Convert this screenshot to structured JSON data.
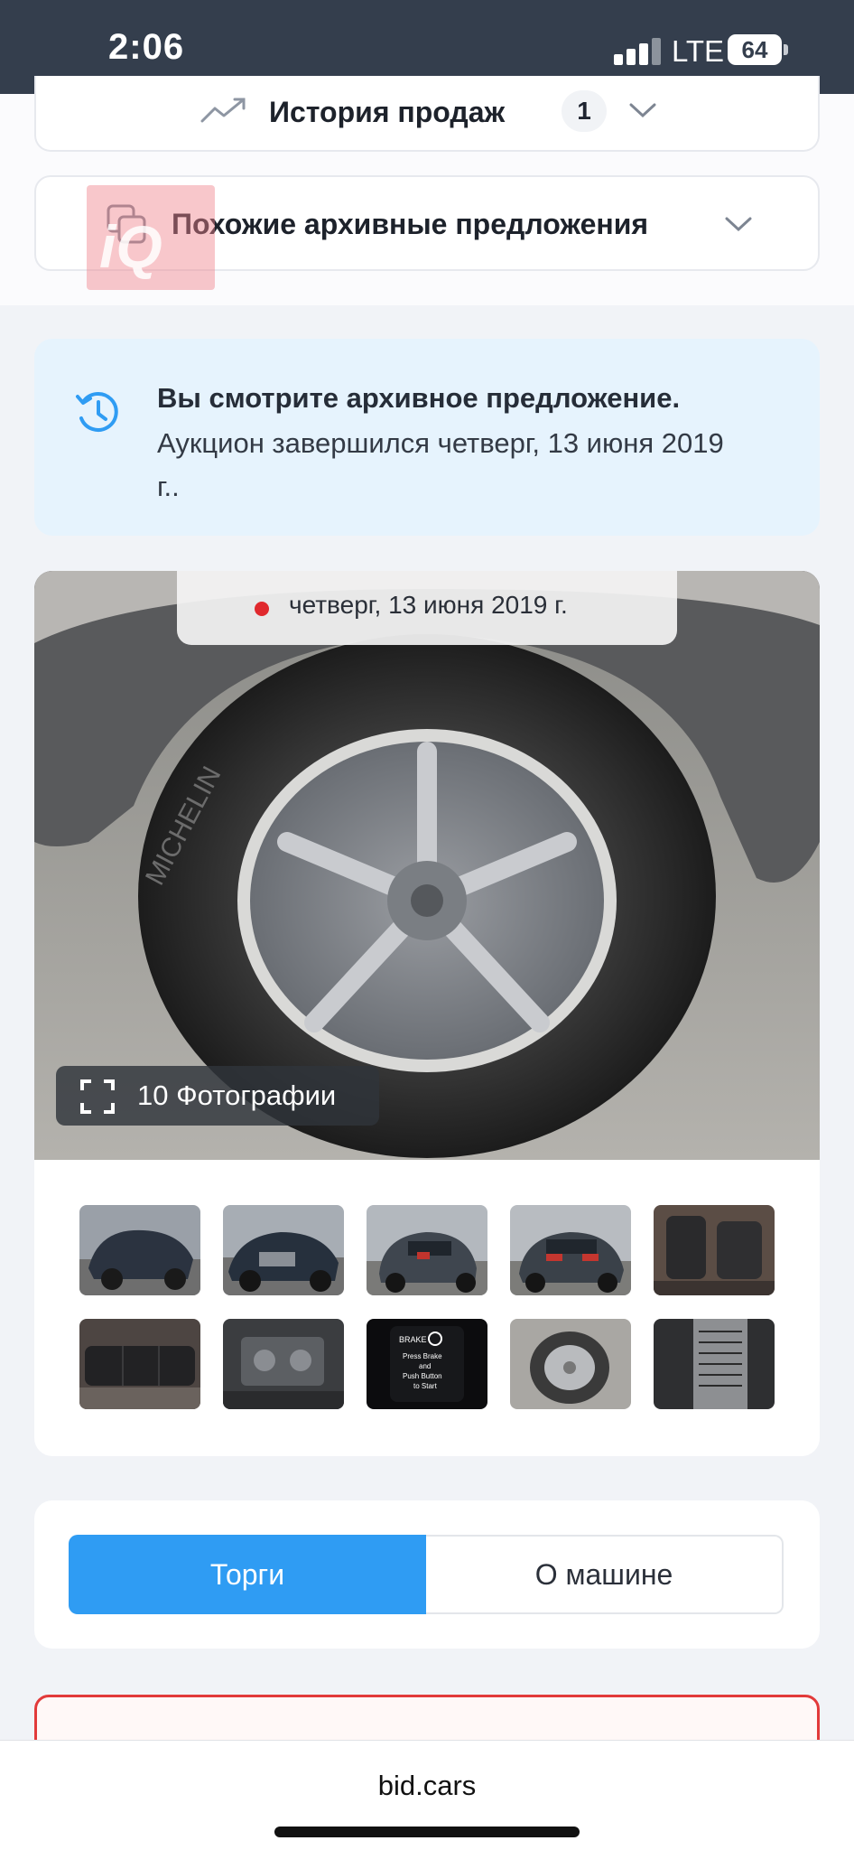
{
  "status_bar": {
    "time": "2:06",
    "network": "LTE",
    "battery": "64"
  },
  "sections": {
    "sales_history": {
      "label": "История продаж",
      "count": "1"
    },
    "similar_archive": {
      "label": "Похожие архивные предложения"
    }
  },
  "notice": {
    "title": "Вы смотрите архивное предложение.",
    "text": "Аукцион завершился четверг, 13 июня 2019 г.."
  },
  "gallery": {
    "date": "четверг, 13 июня 2019 г.",
    "photos_label": "10 Фотографии",
    "thumbnails": [
      "front-left damaged",
      "front right damaged",
      "rear left",
      "rear right",
      "front seats",
      "rear seats",
      "engine bay",
      "dashboard brake message",
      "wheel",
      "door label"
    ],
    "dash_text": [
      "BRAKE",
      "Press Brake",
      "and",
      "Push Button",
      "to Start"
    ]
  },
  "tabs": {
    "auction": "Торги",
    "about_car": "О машине"
  },
  "browser": {
    "url": "bid.cars"
  },
  "colors": {
    "accent": "#2f9cf3",
    "notice_bg": "#e6f3fd",
    "alert_border": "#e23a3a",
    "status_bar": "#343e4d"
  }
}
